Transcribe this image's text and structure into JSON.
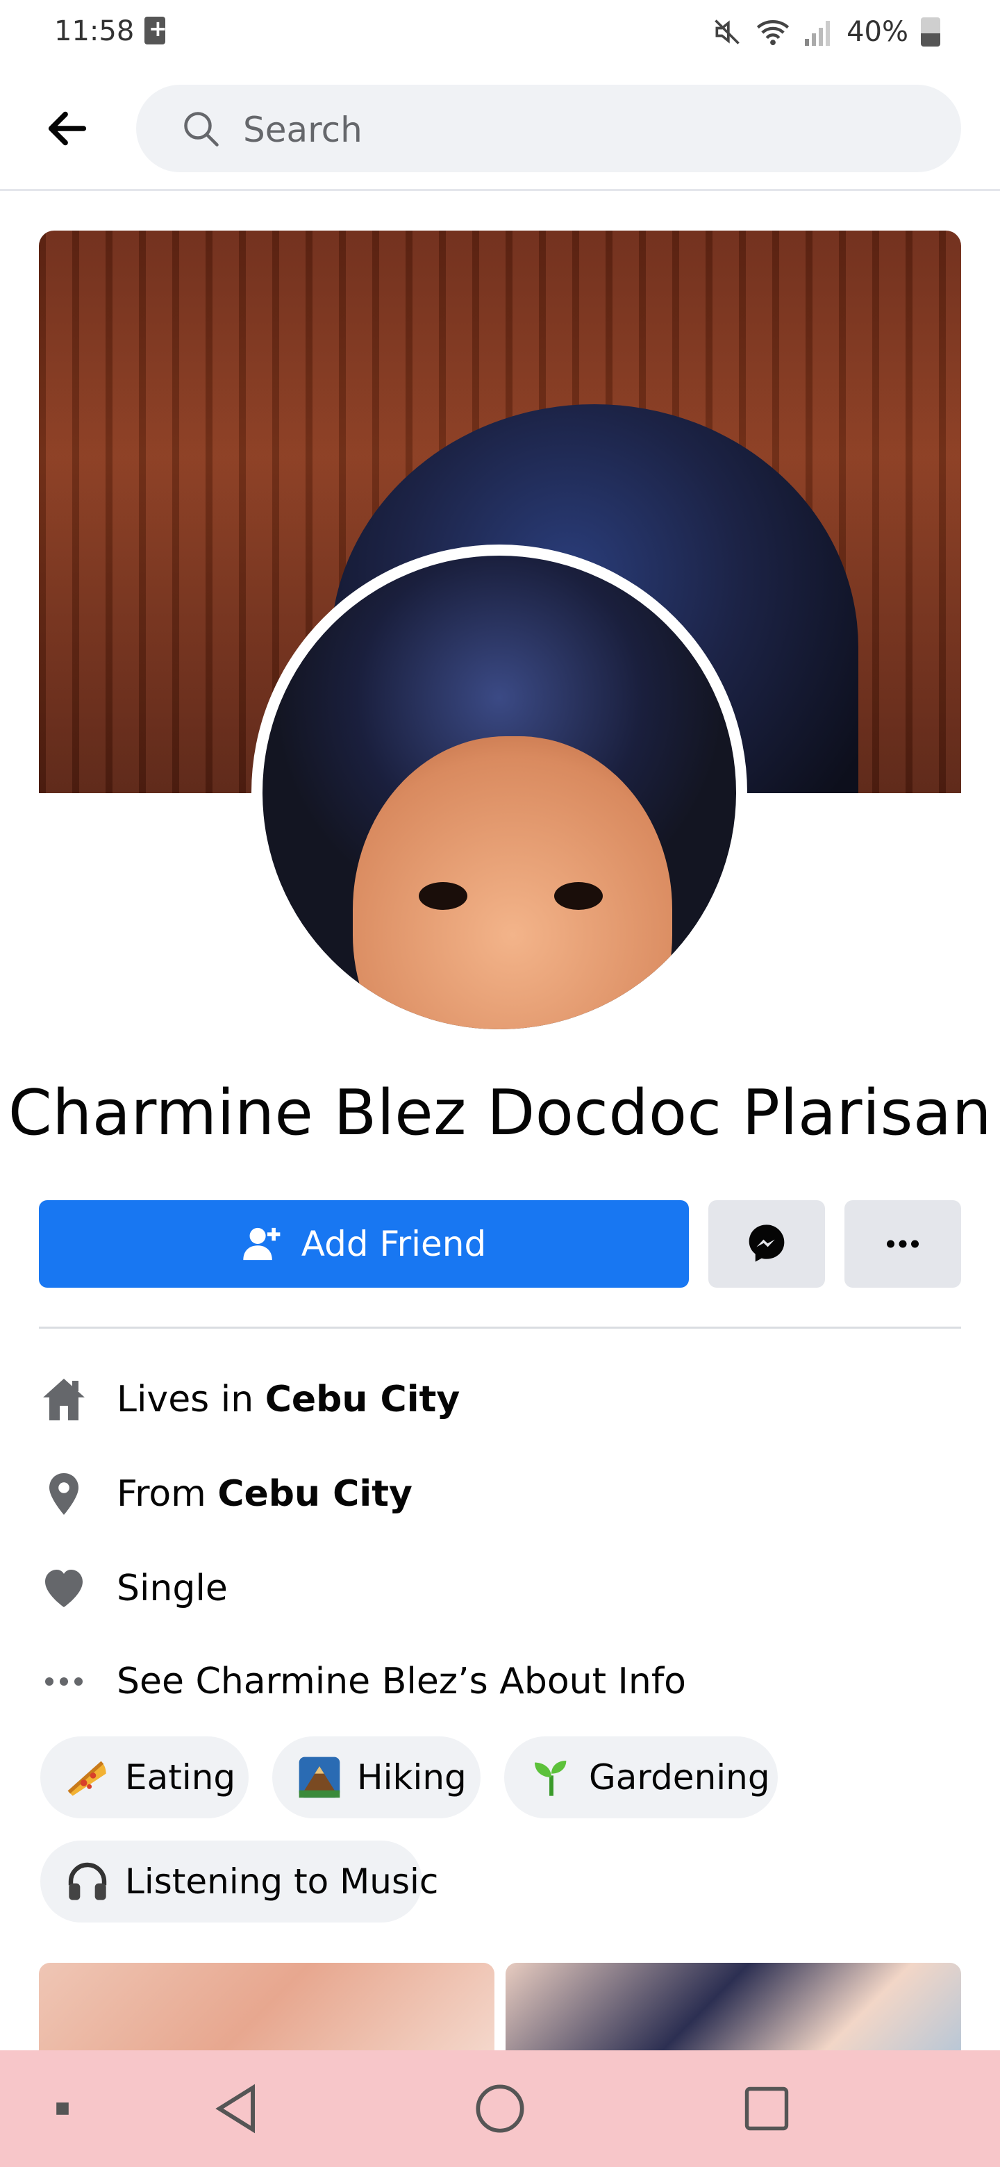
{
  "status_bar": {
    "time": "11:58",
    "battery": "40%"
  },
  "search": {
    "placeholder": "Search"
  },
  "profile": {
    "name": "Charmine Blez Docdoc Plarisan",
    "add_friend_label": "Add Friend"
  },
  "info": {
    "lives_prefix": "Lives in",
    "lives_place": "Cebu City",
    "from_prefix": "From",
    "from_place": "Cebu City",
    "relationship": "Single",
    "about_link": "See Charmine Blez’s About Info"
  },
  "hobbies": [
    {
      "label": "Eating",
      "icon": "pizza-icon"
    },
    {
      "label": "Hiking",
      "icon": "mountain-icon"
    },
    {
      "label": "Gardening",
      "icon": "sprout-icon"
    },
    {
      "label": "Listening to Music",
      "icon": "headphones-icon"
    }
  ],
  "colors": {
    "primary": "#1877f2",
    "chip_bg": "#f0f2f5",
    "nav_bar": "#f7c6c9"
  }
}
